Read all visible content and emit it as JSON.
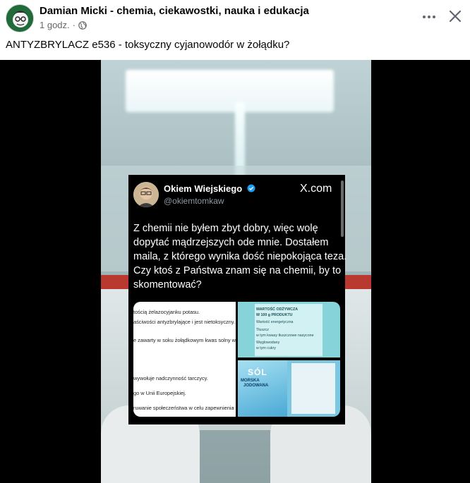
{
  "post": {
    "page_name": "Damian Micki - chemia, ciekawostki, nauka i edukacja",
    "time_ago": "1 godz.",
    "separator": "·",
    "text": "ANTYZBRYLACZ e536 - toksyczny cyjanowodór w żołądku?"
  },
  "icons": {
    "avatar": "avatar-cartoon-scientist",
    "privacy": "globe-icon",
    "more": "more-icon",
    "close": "close-icon",
    "verified": "verified-icon"
  },
  "tweet": {
    "author": "Okiem Wiejskiego",
    "handle": "@okiemtomkaw",
    "platform": "X.com",
    "body_lines": [
      "Z chemii nie byłem zbyt dobry, więc wolę",
      "dopytać mądrzejszych ode mnie. Dostałem",
      "maila, z którego wynika dość niepokojąca teza.",
      "Czy ktoś z Państwa znam się na chemii, by to",
      "skomentować?"
    ]
  },
  "doc_image": {
    "lines": [
      "tością żelazocyjanku potasu.",
      "aściwości antyzbrylające i jest nietoksyczny.",
      "e zawarty w soku żołądkowym kwas solny wche",
      "wywołuje nadczynność tarczycy.",
      "go w Unii Europejskiej.",
      "ruwanie społeczeństwa w celu zapewnienia zy"
    ]
  },
  "nutrition_image": {
    "lines": [
      "WARTOŚĆ ODŻYWCZA",
      "W 100 g PRODUKTU",
      "Wartość energetyczna",
      "Tłuszcz",
      "w tym kwasy tłuszczowe nasycone",
      "Węglowodany",
      "w tym cukry"
    ]
  },
  "salt_image": {
    "title": "SÓL",
    "subtitle_1": "MORSKA",
    "subtitle_2": "JODOWANA"
  },
  "colors": {
    "text_primary": "#050505",
    "text_secondary": "#65676b",
    "tweet_bg": "#000000",
    "verified_blue": "#1d9bf0",
    "shelf_red": "#b9382f"
  }
}
